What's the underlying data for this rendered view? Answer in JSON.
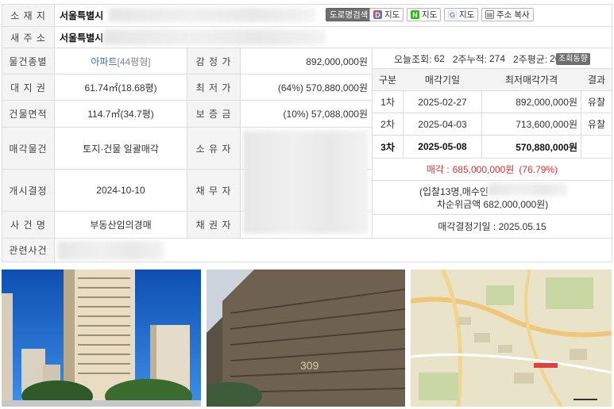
{
  "info": {
    "location_label": "소 재 지",
    "location_value": "서울특별시",
    "new_address_label": "새 주 소",
    "new_address_value": "서울특별시",
    "property_type_label": "물건종별",
    "property_type_value": "아파트",
    "property_type_size": "[44평형]",
    "appraisal_label": "감 정 가",
    "appraisal_value": "892,000,000원",
    "land_right_label": "대 지 권",
    "land_right_value": "61.74㎡(18.68평)",
    "min_price_label": "최 저 가",
    "min_price_value": "(64%) 570,880,000원",
    "building_area_label": "건물면적",
    "building_area_value": "114.7㎡(34.7평)",
    "deposit_label": "보 증 금",
    "deposit_value": "(10%) 57,088,000원",
    "sale_object_label": "매각물건",
    "sale_object_value": "토지·건물 일괄매각",
    "owner_label": "소 유 자",
    "start_decision_label": "개시결정",
    "start_decision_value": "2024-10-10",
    "debtor_label": "채 무 자",
    "case_name_label": "사 건 명",
    "case_name_value": "부동산임의경매",
    "creditor_label": "채 권 자",
    "related_case_label": "관련사건"
  },
  "toolbar": {
    "road_view": "도로명검색",
    "daum_map": "지도",
    "naver_map": "지도",
    "google_map": "지도",
    "copy_address": "주소 복사"
  },
  "stats": {
    "today_label": "오늘조회:",
    "today_value": "62",
    "two_week_total_label": "2주누적:",
    "two_week_total_value": "274",
    "two_week_avg_label": "2주평균:",
    "two_week_avg_value": "20",
    "trend_button": "조회동향"
  },
  "rounds": {
    "headers": [
      "구분",
      "매각기일",
      "최저매각가격",
      "결과"
    ],
    "rows": [
      {
        "round": "1차",
        "date": "2025-02-27",
        "price": "892,000,000원",
        "result": "유찰"
      },
      {
        "round": "2차",
        "date": "2025-04-03",
        "price": "713,600,000원",
        "result": "유찰"
      },
      {
        "round": "3차",
        "date": "2025-05-08",
        "price": "570,880,000원",
        "result": ""
      }
    ],
    "sale_label": "매각 :",
    "sale_price": "685,000,000원",
    "sale_ratio": "(76.79%)",
    "bid_line": "(입찰13명,매수인",
    "second_bid_line": "차순위금액 682,000,000원)",
    "decision_line": "매각결정기일 : 2025.05.15"
  },
  "colors": {
    "label_bg": "#f4f4f4",
    "link_blue": "#3b6fb6",
    "sale_red": "#e0312f",
    "trend_button_bg": "#6f6f6f"
  },
  "photos": {
    "photo1_icon": "apartment-exterior-photo",
    "photo2_icon": "building-facade-photo",
    "photo3_icon": "location-map-photo",
    "photo2_building_number": "309"
  }
}
